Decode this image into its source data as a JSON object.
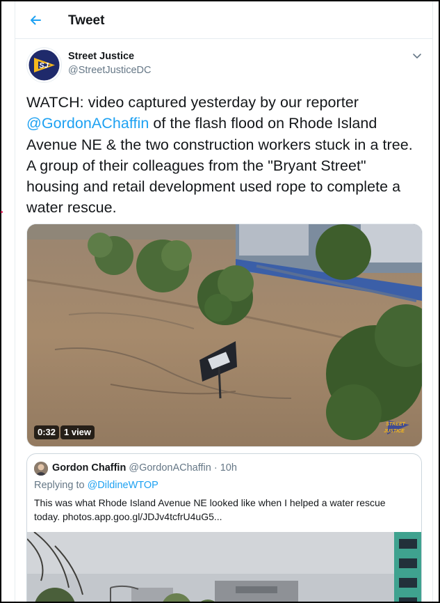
{
  "header": {
    "title": "Tweet"
  },
  "author": {
    "name": "Street Justice",
    "handle": "@StreetJusticeDC",
    "avatar_text": "SJ"
  },
  "tweet": {
    "text_before": "WATCH: video captured yesterday by our reporter ",
    "mention": "@GordonAChaffin",
    "text_after": " of the flash flood on Rhode Island Avenue NE & the two construction workers stuck in a tree. A group of their colleagues from the \"Bryant Street\" housing and retail development used rope to complete a  water rescue."
  },
  "video": {
    "duration": "0:32",
    "views": "1 view",
    "watermark_line1": "STREET",
    "watermark_line2": "JUSTICE"
  },
  "quote": {
    "name": "Gordon Chaffin",
    "handle": "@GordonAChaffin",
    "separator": "·",
    "time": "10h",
    "replying_prefix": "Replying to ",
    "replying_to": "@DildineWTOP",
    "text": "This was what Rhode Island Avenue NE looked like when I helped a water rescue today. photos.app.goo.gl/JDJv4tcfrU4uG5..."
  },
  "colors": {
    "accent": "#1da1f2",
    "secondary_text": "#657786",
    "border": "#e6ecf0"
  }
}
